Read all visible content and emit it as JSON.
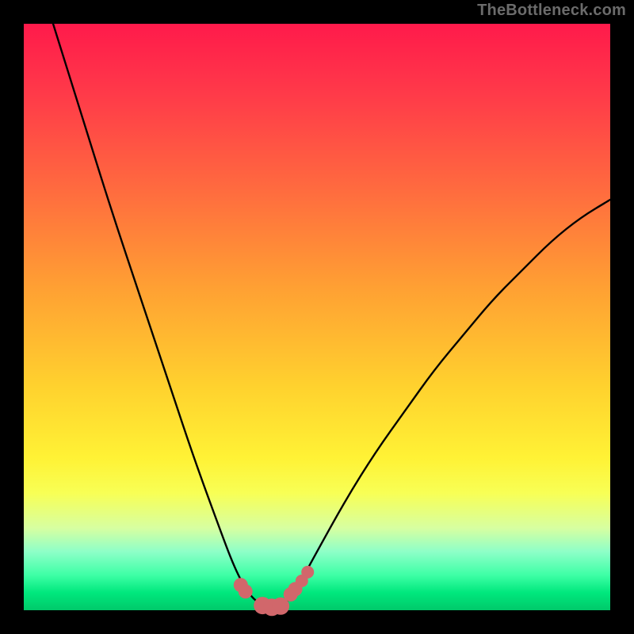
{
  "watermark": "TheBottleneck.com",
  "chart_data": {
    "type": "line",
    "title": "",
    "xlabel": "",
    "ylabel": "",
    "xlim": [
      0,
      100
    ],
    "ylim": [
      0,
      100
    ],
    "grid": false,
    "legend": false,
    "series": [
      {
        "name": "curve",
        "color": "#000000",
        "x": [
          5,
          10,
          15,
          20,
          25,
          29,
          33,
          36,
          38.5,
          40.7,
          42.3,
          43.8,
          44.8,
          47,
          50,
          55,
          60,
          65,
          70,
          75,
          80,
          85,
          90,
          95,
          100
        ],
        "y": [
          100,
          84,
          68,
          53,
          38,
          26,
          15,
          7,
          2.5,
          0.8,
          0.5,
          0.7,
          1.3,
          4.5,
          10,
          19,
          27,
          34,
          41,
          47,
          53,
          58,
          63,
          67,
          70
        ],
        "note": "Values estimated from pixel positions; y=0 is bottom (green band), y=100 is top (pink)."
      },
      {
        "name": "marker-band",
        "color": "#d1676b",
        "type": "scatter",
        "x": [
          37.0,
          37.8,
          40.7,
          42.3,
          43.8,
          45.5,
          46.3,
          47.4,
          48.4
        ],
        "y": [
          4.3,
          3.2,
          0.8,
          0.5,
          0.7,
          2.7,
          3.6,
          5.0,
          6.5
        ],
        "marker_radius_px": [
          9,
          9,
          11,
          11,
          11,
          9,
          9,
          8,
          8
        ],
        "note": "Chunky pink dots near the curve minimum; radii in screen pixels."
      }
    ]
  },
  "colors": {
    "frame": "#000000",
    "curve": "#000000",
    "markers": "#d1676b",
    "watermark": "#6b6b6b"
  }
}
